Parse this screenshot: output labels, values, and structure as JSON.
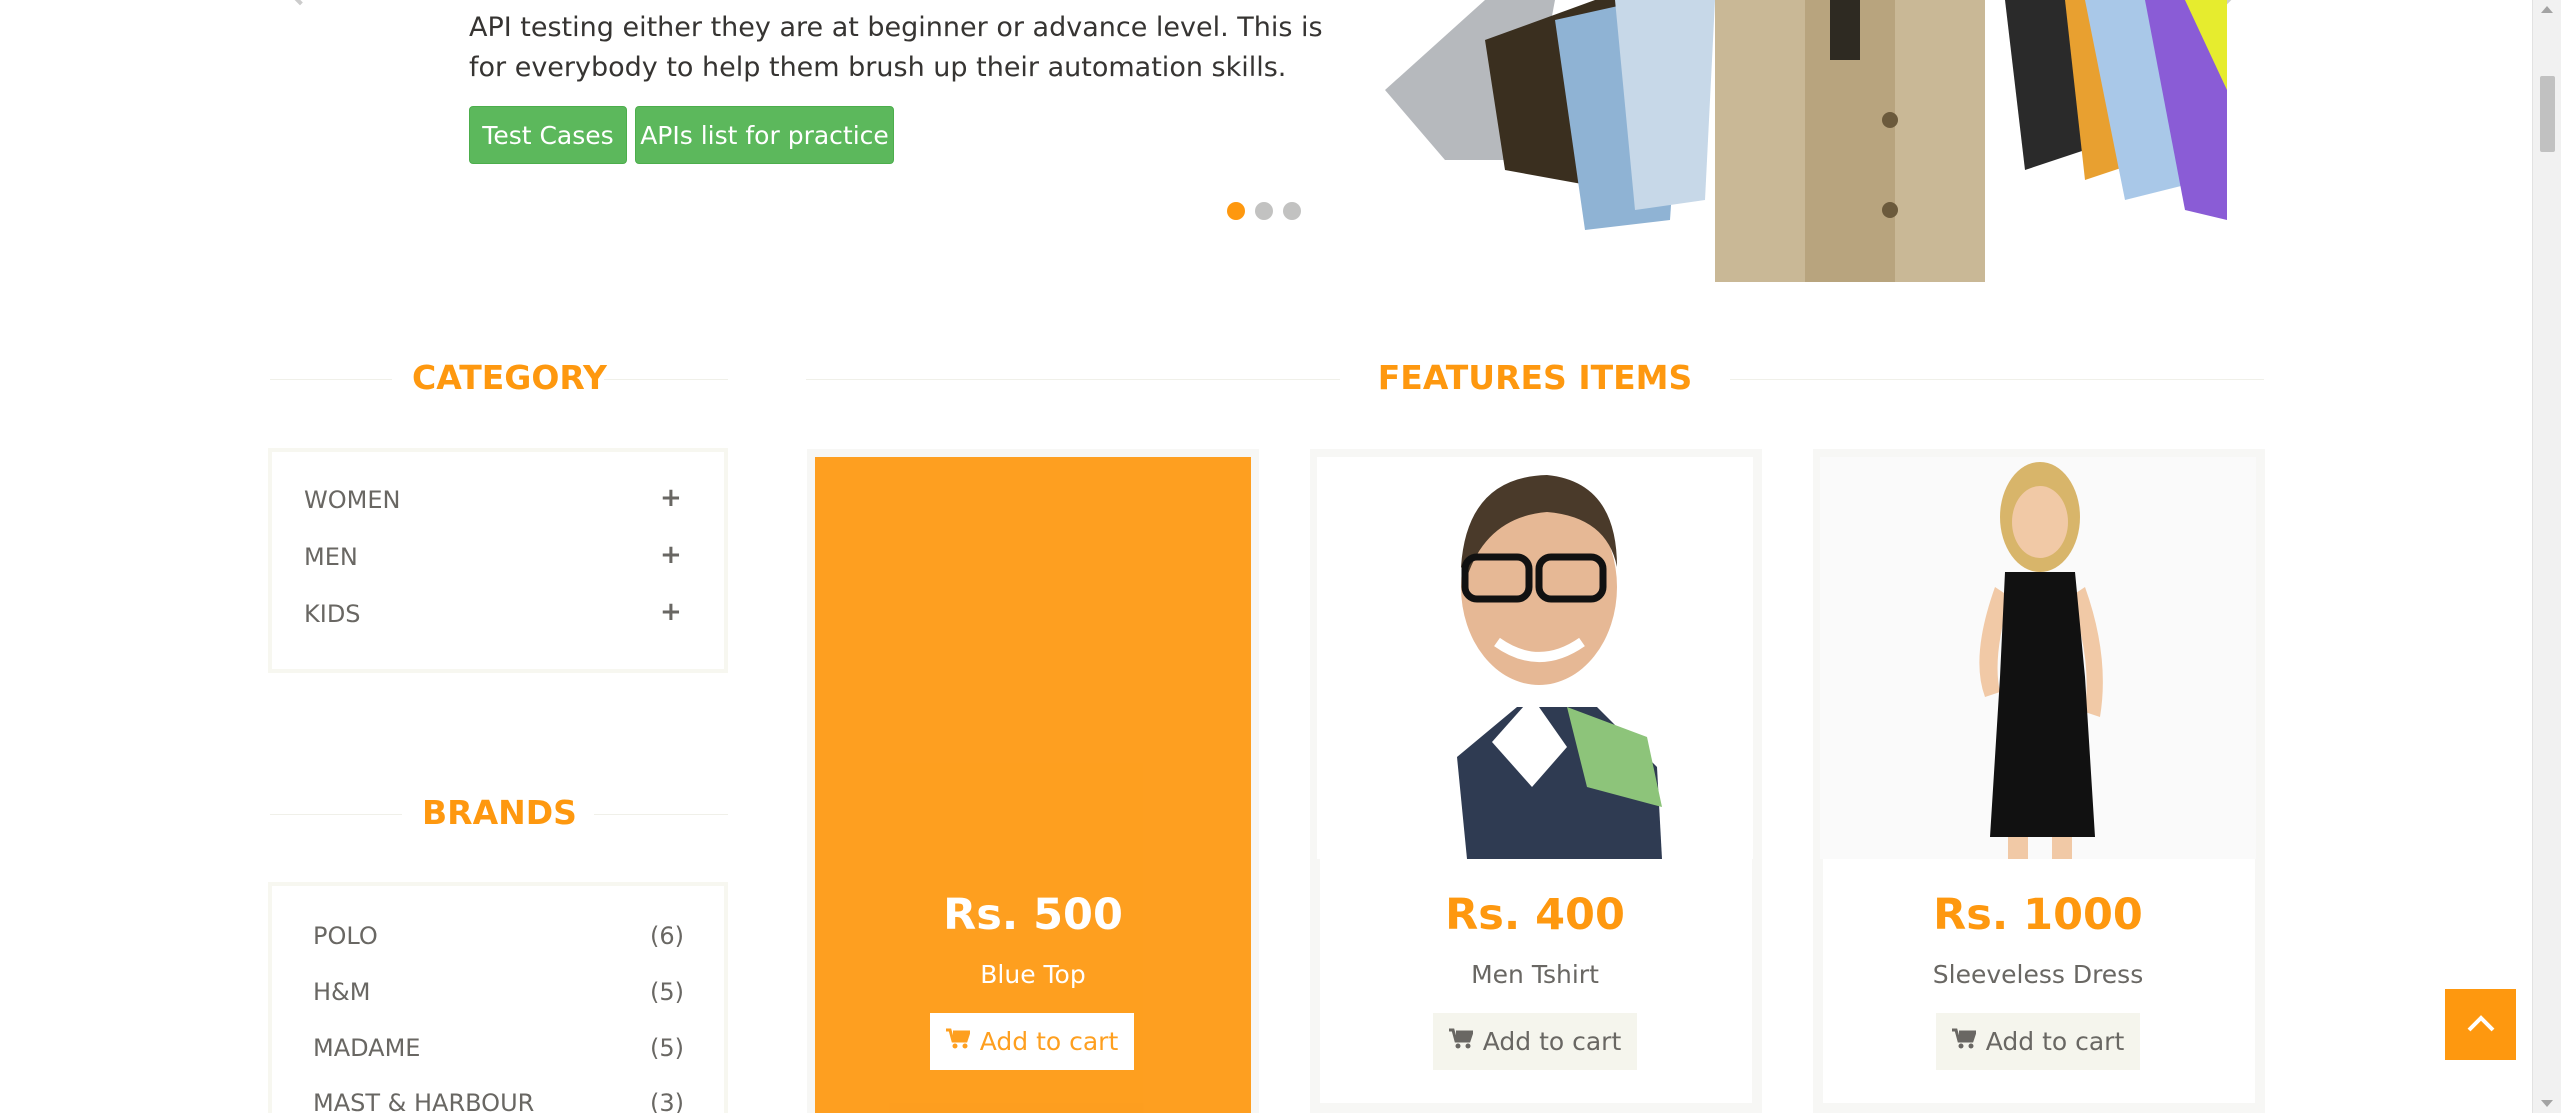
{
  "slider": {
    "text": "API testing either they are at beginner or advance level. This is for everybody to help them brush up their automation skills.",
    "test_cases_label": "Test Cases",
    "apis_label": "APIs list for practice"
  },
  "category": {
    "title": "CATEGORY",
    "items": [
      {
        "label": "WOMEN",
        "icon": "+"
      },
      {
        "label": "MEN",
        "icon": "+"
      },
      {
        "label": "KIDS",
        "icon": "+"
      }
    ]
  },
  "brands": {
    "title": "BRANDS",
    "items": [
      {
        "label": "POLO",
        "count": "(6)"
      },
      {
        "label": "H&M",
        "count": "(5)"
      },
      {
        "label": "MADAME",
        "count": "(5)"
      },
      {
        "label": "MAST & HARBOUR",
        "count": "(3)"
      }
    ]
  },
  "features": {
    "title": "FEATURES ITEMS",
    "products": [
      {
        "price": "Rs. 500",
        "name": "Blue Top",
        "cart_label": "Add to cart"
      },
      {
        "price": "Rs. 400",
        "name": "Men Tshirt",
        "cart_label": "Add to cart"
      },
      {
        "price": "Rs. 1000",
        "name": "Sleeveless Dress",
        "cart_label": "Add to cart"
      }
    ]
  },
  "colors": {
    "accent": "#fe980f",
    "green": "#5cb85c"
  }
}
